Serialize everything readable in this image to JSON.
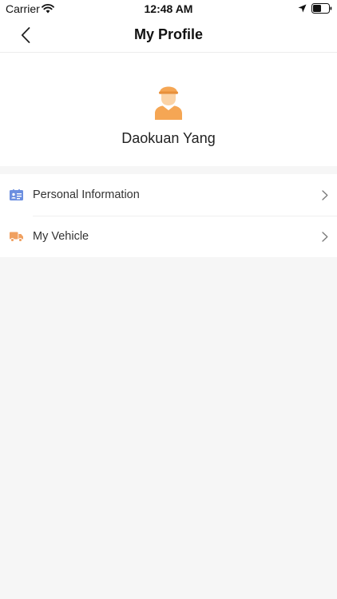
{
  "status_bar": {
    "carrier": "Carrier",
    "time": "12:48 AM",
    "icons": [
      "wifi-icon",
      "location-arrow-icon",
      "battery-icon"
    ]
  },
  "nav": {
    "title": "My Profile",
    "back_icon": "chevron-left-icon"
  },
  "profile": {
    "name": "Daokuan Yang",
    "avatar_icon": "courier-avatar-icon"
  },
  "menu": {
    "items": [
      {
        "label": "Personal Information",
        "icon": "id-card-icon",
        "icon_color": "#6c8fe0"
      },
      {
        "label": "My Vehicle",
        "icon": "truck-icon",
        "icon_color": "#f0a060"
      }
    ]
  },
  "colors": {
    "background": "#f6f6f6",
    "surface": "#ffffff",
    "avatar_orange": "#f5a654",
    "id_card_blue": "#6c8fe0",
    "truck_orange": "#f0a060"
  }
}
